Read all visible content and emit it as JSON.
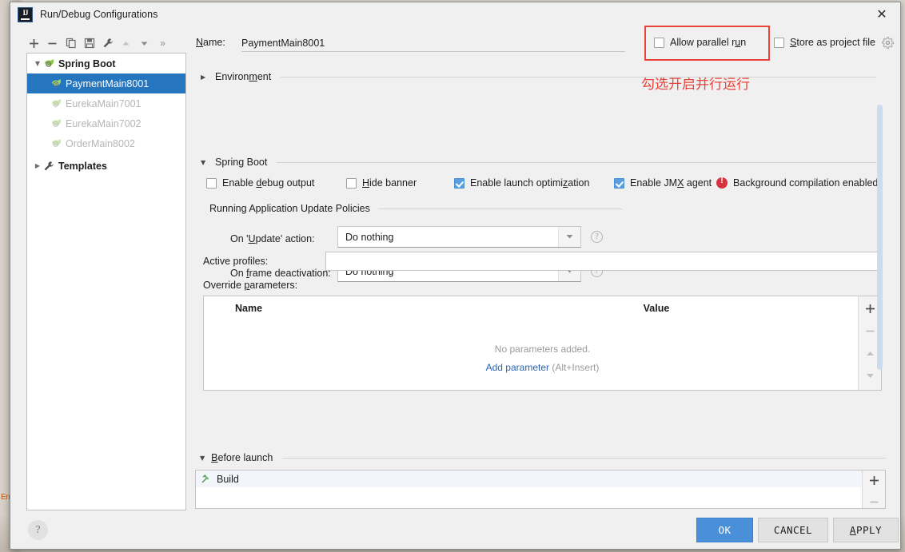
{
  "window": {
    "title": "Run/Debug Configurations",
    "logo_icon": "intellij-idea-logo",
    "close_icon": "close-icon"
  },
  "toolbar": {
    "add_icon": "plus-icon",
    "remove_icon": "minus-icon",
    "copy_icon": "copy-icon",
    "save_icon": "save-icon",
    "edit_templates_icon": "wrench-icon",
    "move_up_icon": "arrow-up-icon",
    "move_down_icon": "arrow-down-icon",
    "more_label": "»"
  },
  "name_row": {
    "label": "Name:",
    "label_mnemonic": "N",
    "value": "PaymentMain8001",
    "placeholder": "",
    "allow_parallel_run": {
      "label": "Allow parallel run",
      "mnemonic": "u",
      "checked": false
    },
    "store_as_project_file": {
      "label": "Store as project file",
      "mnemonic": "S",
      "checked": false
    },
    "gear_icon": "gear-icon"
  },
  "annotation": {
    "text": "勾选开启并行运行",
    "color": "#e8443a",
    "box_color": "#e8443a"
  },
  "sidebar": {
    "items": [
      {
        "label": "Spring Boot",
        "type": "group",
        "icon": "spring-boot-icon",
        "expanded": true,
        "selected": false,
        "muted": false
      },
      {
        "label": "PaymentMain8001",
        "type": "child",
        "icon": "spring-boot-icon",
        "selected": true,
        "muted": false
      },
      {
        "label": "EurekaMain7001",
        "type": "child",
        "icon": "spring-boot-icon",
        "selected": false,
        "muted": true
      },
      {
        "label": "EurekaMain7002",
        "type": "child",
        "icon": "spring-boot-icon",
        "selected": false,
        "muted": true
      },
      {
        "label": "OrderMain8002",
        "type": "child",
        "icon": "spring-boot-icon",
        "selected": false,
        "muted": true
      },
      {
        "label": "Templates",
        "type": "group",
        "icon": "wrench-icon",
        "expanded": false,
        "selected": false,
        "muted": false
      }
    ]
  },
  "main": {
    "environment_section": {
      "label": "Environment",
      "mnemonic": "m",
      "expanded": false
    },
    "spring_boot_section": {
      "label": "Spring Boot",
      "mnemonic": "g",
      "expanded": true,
      "checkboxes": [
        {
          "label": "Enable debug output",
          "mnemonic": "d",
          "checked": false
        },
        {
          "label": "Hide banner",
          "mnemonic": "H",
          "checked": false
        },
        {
          "label": "Enable launch optimization",
          "mnemonic": "z",
          "checked": true
        },
        {
          "label": "Enable JMX agent",
          "mnemonic": "X",
          "checked": true
        }
      ],
      "warning": {
        "icon": "error-icon",
        "text": "Background compilation enabled",
        "color": "#d4333f"
      }
    },
    "update_policies": {
      "title": "Running Application Update Policies",
      "rows": [
        {
          "label": "On 'Update' action:",
          "mnemonic": "U",
          "value": "Do nothing",
          "help_icon": "help-icon",
          "dropdown_icon": "chevron-down-icon"
        },
        {
          "label": "On frame deactivation:",
          "mnemonic": "f",
          "value": "Do nothing",
          "help_icon": "help-icon",
          "dropdown_icon": "chevron-down-icon"
        }
      ]
    },
    "active_profiles": {
      "label": "Active profiles:",
      "value": "",
      "placeholder": ""
    },
    "override_parameters": {
      "label": "Override parameters:",
      "mnemonic": "p",
      "columns": [
        "Name",
        "Value"
      ],
      "rows": [],
      "empty_text": "No parameters added.",
      "add_link": "Add parameter",
      "add_hint": "(Alt+Insert)",
      "side_buttons": [
        {
          "icon": "plus-icon",
          "enabled": true
        },
        {
          "icon": "minus-icon",
          "enabled": false
        },
        {
          "icon": "arrow-up-icon",
          "enabled": false
        },
        {
          "icon": "arrow-down-icon",
          "enabled": false
        }
      ]
    },
    "scrollbar": {
      "thumb_color": "#cbdcf0"
    }
  },
  "before_launch": {
    "label": "Before launch",
    "mnemonic": "B",
    "expanded": true,
    "items": [
      {
        "label": "Build",
        "icon": "build-hammer-icon"
      }
    ],
    "side_buttons": [
      {
        "icon": "plus-icon",
        "enabled": true
      },
      {
        "icon": "minus-icon",
        "enabled": false
      }
    ]
  },
  "footer": {
    "help_icon": "question-mark-icon",
    "ok_label": "OK",
    "cancel_label": "CANCEL",
    "apply_label": "APPLY",
    "apply_mnemonic": "A",
    "ok_color": "#4a90d9"
  },
  "backdrop": {
    "left_edge_text": "En"
  }
}
